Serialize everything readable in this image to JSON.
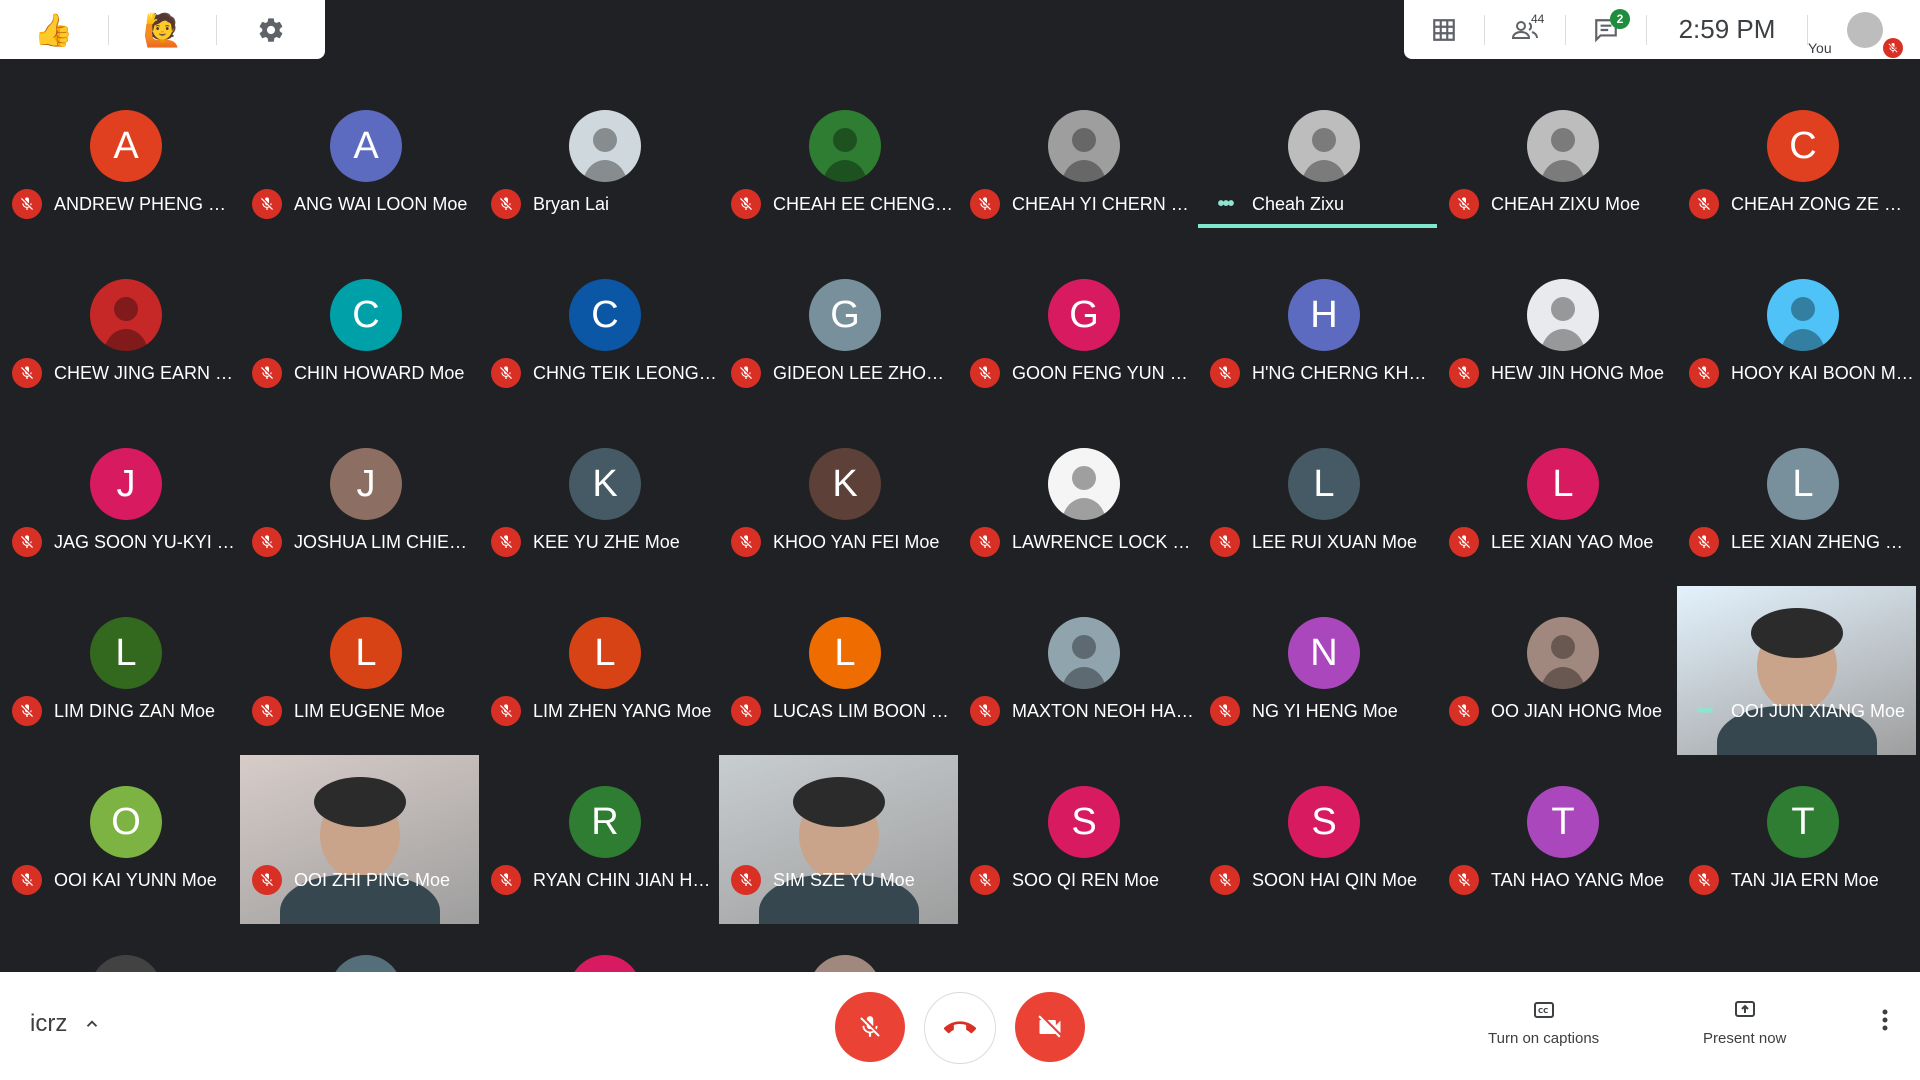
{
  "topbar_right": {
    "people_count": "44",
    "chat_count": "2",
    "time": "2:59  PM",
    "you_label": "You"
  },
  "participants": [
    {
      "name": "ANDREW PHENG QI JI...",
      "initial": "A",
      "color": "#e0401f",
      "kind": "letter",
      "status": "muted"
    },
    {
      "name": "ANG WAI LOON Moe",
      "initial": "A",
      "color": "#5c6bc0",
      "kind": "letter",
      "status": "muted"
    },
    {
      "name": "Bryan Lai",
      "initial": "",
      "color": "#cfd8dc",
      "kind": "photo",
      "status": "muted"
    },
    {
      "name": "CHEAH EE CHENG Moe",
      "initial": "",
      "color": "#2e7d32",
      "kind": "photo",
      "status": "muted"
    },
    {
      "name": "CHEAH YI CHERN Moe",
      "initial": "",
      "color": "#9e9e9e",
      "kind": "photo",
      "status": "muted"
    },
    {
      "name": "Cheah Zixu",
      "initial": "",
      "color": "#bdbdbd",
      "kind": "photo",
      "status": "talking"
    },
    {
      "name": "CHEAH ZIXU Moe",
      "initial": "",
      "color": "#bdbdbd",
      "kind": "photo",
      "status": "muted"
    },
    {
      "name": "CHEAH ZONG ZE Moe",
      "initial": "C",
      "color": "#e0401f",
      "kind": "letter",
      "status": "muted"
    },
    {
      "name": "CHEW JING EARN Moe",
      "initial": "",
      "color": "#c62828",
      "kind": "photo",
      "status": "muted"
    },
    {
      "name": "CHIN HOWARD Moe",
      "initial": "C",
      "color": "#00a0a8",
      "kind": "letter",
      "status": "muted"
    },
    {
      "name": "CHNG TEIK LEONG M...",
      "initial": "C",
      "color": "#0b57a5",
      "kind": "letter",
      "status": "muted"
    },
    {
      "name": "GIDEON LEE ZHONG ...",
      "initial": "G",
      "color": "#78909c",
      "kind": "letter",
      "status": "muted"
    },
    {
      "name": "GOON FENG YUN Moe",
      "initial": "G",
      "color": "#d81b60",
      "kind": "letter",
      "status": "muted"
    },
    {
      "name": "H'NG CHERNG KHAI ...",
      "initial": "H",
      "color": "#5c6bc0",
      "kind": "letter",
      "status": "muted"
    },
    {
      "name": "HEW JIN HONG Moe",
      "initial": "",
      "color": "#e8eaed",
      "kind": "photo",
      "status": "muted"
    },
    {
      "name": "HOOY KAI BOON Moe",
      "initial": "",
      "color": "#4fc3f7",
      "kind": "photo",
      "status": "muted"
    },
    {
      "name": "JAG SOON YU-KYI Moe",
      "initial": "J",
      "color": "#d81b60",
      "kind": "letter",
      "status": "muted"
    },
    {
      "name": "JOSHUA LIM CHIEW ...",
      "initial": "J",
      "color": "#8d6e63",
      "kind": "letter",
      "status": "muted"
    },
    {
      "name": "KEE YU ZHE Moe",
      "initial": "K",
      "color": "#455a64",
      "kind": "letter",
      "status": "muted"
    },
    {
      "name": "KHOO YAN FEI Moe",
      "initial": "K",
      "color": "#5d4037",
      "kind": "letter",
      "status": "muted"
    },
    {
      "name": "LAWRENCE LOCK CH...",
      "initial": "",
      "color": "#f5f5f5",
      "kind": "photo",
      "status": "muted"
    },
    {
      "name": "LEE RUI XUAN Moe",
      "initial": "L",
      "color": "#455a64",
      "kind": "letter",
      "status": "muted"
    },
    {
      "name": "LEE XIAN YAO Moe",
      "initial": "L",
      "color": "#d81b60",
      "kind": "letter",
      "status": "muted"
    },
    {
      "name": "LEE XIAN ZHENG Moe",
      "initial": "L",
      "color": "#78909c",
      "kind": "letter",
      "status": "muted"
    },
    {
      "name": "LIM DING ZAN Moe",
      "initial": "L",
      "color": "#33691e",
      "kind": "letter",
      "status": "muted"
    },
    {
      "name": "LIM EUGENE Moe",
      "initial": "L",
      "color": "#d84315",
      "kind": "letter",
      "status": "muted"
    },
    {
      "name": "LIM ZHEN YANG Moe",
      "initial": "L",
      "color": "#d84315",
      "kind": "letter",
      "status": "muted"
    },
    {
      "name": "LUCAS LIM BOON TE...",
      "initial": "L",
      "color": "#ef6c00",
      "kind": "letter",
      "status": "muted"
    },
    {
      "name": "MAXTON NEOH HAO ...",
      "initial": "",
      "color": "#90a4ae",
      "kind": "photo",
      "status": "muted"
    },
    {
      "name": "NG YI HENG Moe",
      "initial": "N",
      "color": "#ab47bc",
      "kind": "letter",
      "status": "muted"
    },
    {
      "name": "OO JIAN HONG Moe",
      "initial": "",
      "color": "#a1887f",
      "kind": "photo",
      "status": "muted"
    },
    {
      "name": "OOI JUN XIANG Moe",
      "initial": "",
      "color": "#e3f2fd",
      "kind": "video",
      "status": "talking"
    },
    {
      "name": "OOI KAI YUNN Moe",
      "initial": "O",
      "color": "#7cb342",
      "kind": "letter",
      "status": "muted"
    },
    {
      "name": "OOI ZHI PING Moe",
      "initial": "",
      "color": "#d7ccc8",
      "kind": "video",
      "status": "muted"
    },
    {
      "name": "RYAN CHIN JIAN HW...",
      "initial": "R",
      "color": "#2e7d32",
      "kind": "letter",
      "status": "muted"
    },
    {
      "name": "SIM SZE YU Moe",
      "initial": "",
      "color": "#c8cdd0",
      "kind": "video",
      "status": "muted"
    },
    {
      "name": "SOO QI REN Moe",
      "initial": "S",
      "color": "#d81b60",
      "kind": "letter",
      "status": "muted"
    },
    {
      "name": "SOON HAI QIN Moe",
      "initial": "S",
      "color": "#d81b60",
      "kind": "letter",
      "status": "muted"
    },
    {
      "name": "TAN HAO YANG Moe",
      "initial": "T",
      "color": "#ab47bc",
      "kind": "letter",
      "status": "muted"
    },
    {
      "name": "TAN JIA ERN Moe",
      "initial": "T",
      "color": "#2e7d32",
      "kind": "letter",
      "status": "muted"
    }
  ],
  "partial_row_colors": [
    "#424242",
    "#546e7a",
    "#d81b60",
    "#a1887f"
  ],
  "bottom_bar": {
    "meeting_code": "icrz",
    "captions_label": "Turn on captions",
    "present_label": "Present now"
  }
}
